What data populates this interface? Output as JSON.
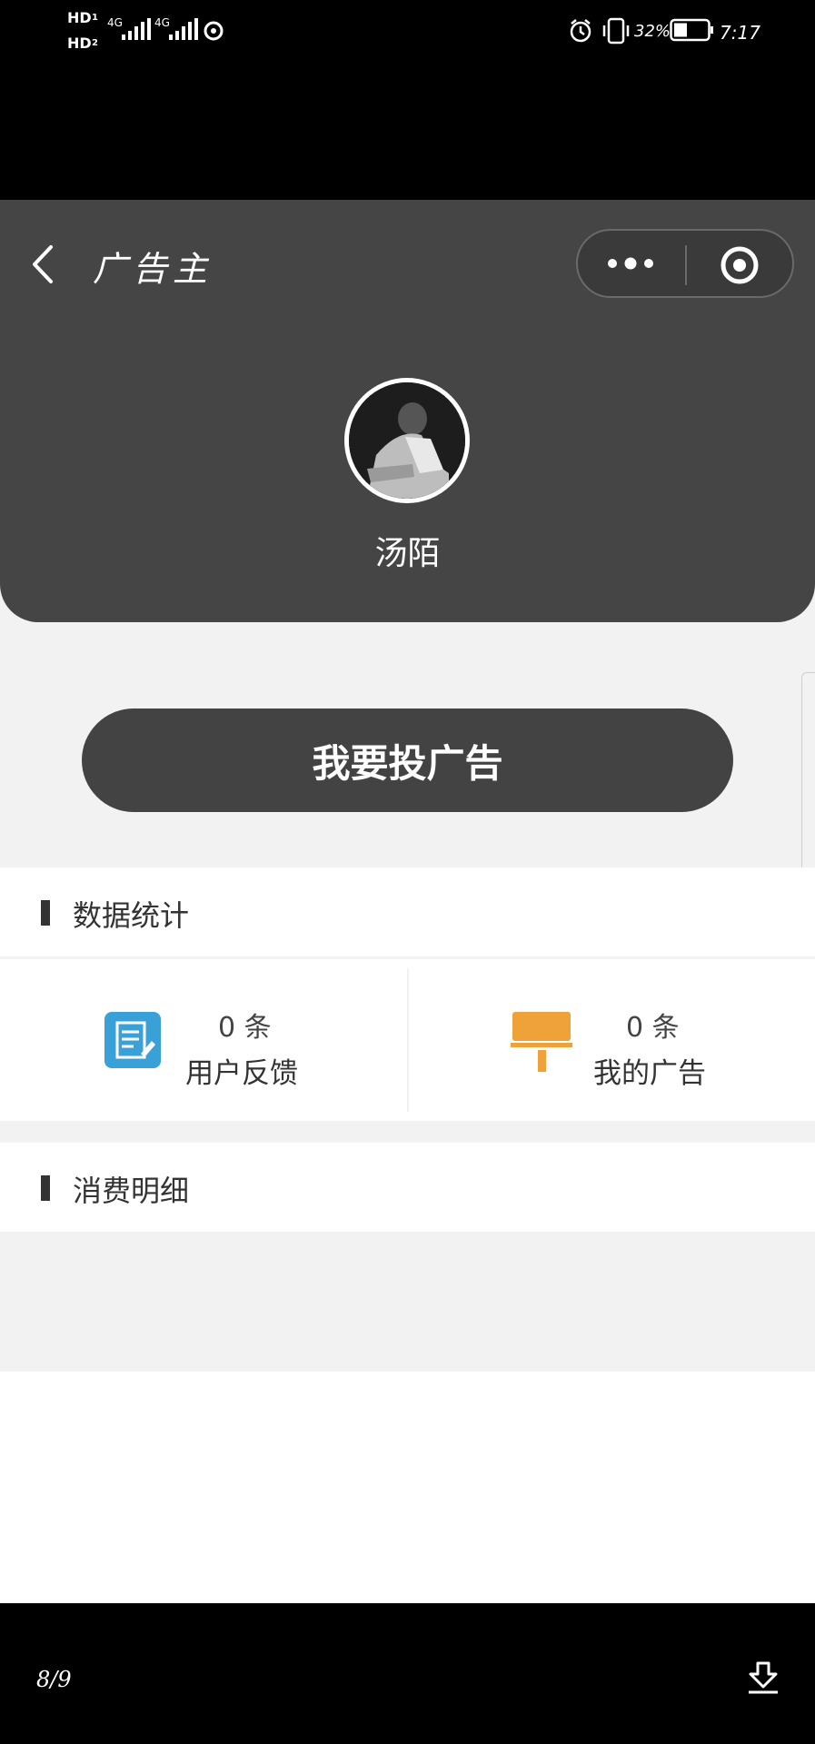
{
  "status_bar": {
    "sim1_label": "HD",
    "sim2_label": "HD",
    "sim1_sub": "1",
    "sim2_sub": "2",
    "network1": "4G",
    "network2": "4G",
    "battery_percent": "32%",
    "time": "7:17"
  },
  "nav": {
    "title": "广告主",
    "more_icon": "more-dots-icon",
    "close_icon": "target-close-icon"
  },
  "profile": {
    "username": "汤陌"
  },
  "actions": {
    "post_ad_label": "我要投广告"
  },
  "stats_section": {
    "title": "数据统计",
    "items": [
      {
        "count": "0 条",
        "label": "用户反馈",
        "icon": "feedback-note-icon",
        "color": "#3aa0d8"
      },
      {
        "count": "0 条",
        "label": "我的广告",
        "icon": "ad-brush-icon",
        "color": "#f0a23a"
      }
    ]
  },
  "spending_section": {
    "title": "消费明细"
  },
  "viewer": {
    "page_counter": "8/9",
    "download_icon": "download-icon"
  },
  "colors": {
    "header_bg": "#454545",
    "page_bg": "#f2f2f2",
    "accent_blue": "#3aa0d8",
    "accent_orange": "#f0a23a"
  }
}
